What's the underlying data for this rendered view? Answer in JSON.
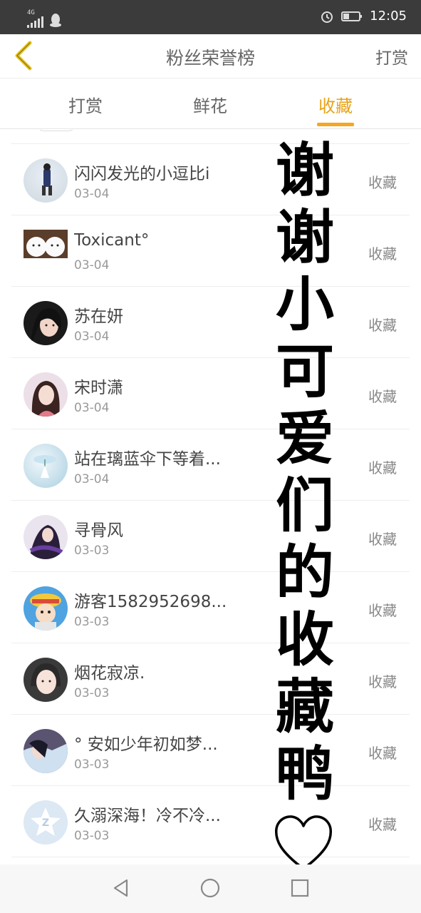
{
  "status_bar": {
    "network": "4G",
    "time": "12:05",
    "icons": [
      "signal-icon",
      "qq-icon",
      "alarm-icon",
      "battery-icon"
    ]
  },
  "nav": {
    "title": "粉丝荣誉榜",
    "right_label": "打赏",
    "back_icon": "chevron-left-icon"
  },
  "tabs": [
    {
      "label": "打赏",
      "active": false
    },
    {
      "label": "鲜花",
      "active": false
    },
    {
      "label": "收藏",
      "active": true
    }
  ],
  "colors": {
    "accent": "#f5a623",
    "back_icon": "#e8c21a"
  },
  "rows": [
    {
      "name": "闪闪发光的小逗比i",
      "date": "03-04",
      "action": "收藏"
    },
    {
      "name": "Toxicant°",
      "date": "03-04",
      "action": "收藏"
    },
    {
      "name": "苏在妍",
      "date": "03-04",
      "action": "收藏"
    },
    {
      "name": "宋时潇",
      "date": "03-04",
      "action": "收藏"
    },
    {
      "name": "站在璃蓝伞下等着...",
      "date": "03-04",
      "action": "收藏"
    },
    {
      "name": "寻骨风",
      "date": "03-03",
      "action": "收藏"
    },
    {
      "name": "游客1582952698...",
      "date": "03-03",
      "action": "收藏"
    },
    {
      "name": "烟花寂凉.",
      "date": "03-03",
      "action": "收藏"
    },
    {
      "name": "° 安如少年初如梦...",
      "date": "03-03",
      "action": "收藏"
    },
    {
      "name": "久溺深海！冷不冷...",
      "date": "03-03",
      "action": "收藏"
    }
  ],
  "overlay": {
    "chars": [
      "谢",
      "谢",
      "小",
      "可",
      "爱",
      "们",
      "的",
      "收",
      "藏",
      "鸭"
    ]
  }
}
